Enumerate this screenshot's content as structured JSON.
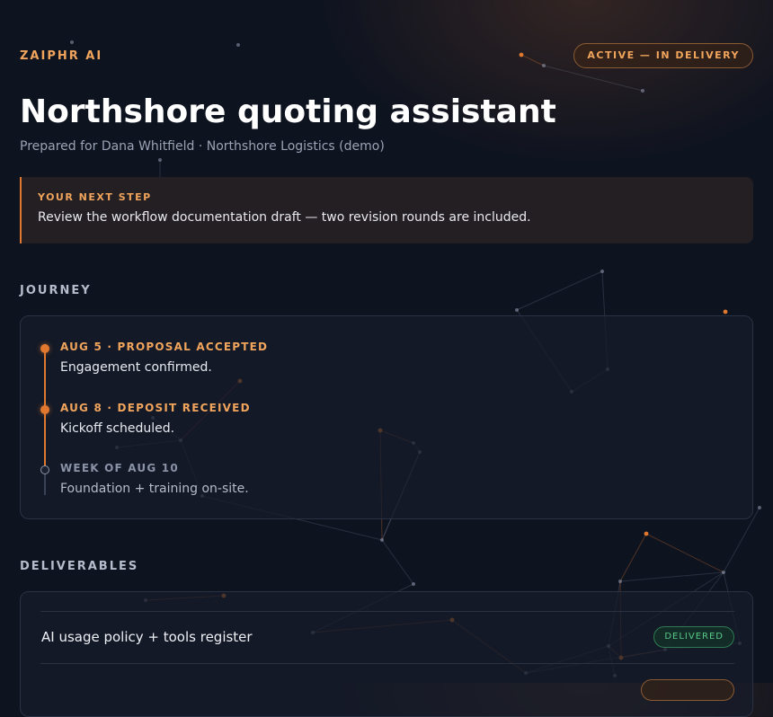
{
  "header": {
    "brand": "ZAIPHR AI",
    "status": "ACTIVE — IN DELIVERY",
    "title": "Northshore quoting assistant",
    "subtitle": "Prepared for Dana Whitfield · Northshore Logistics (demo)"
  },
  "next_step": {
    "label": "YOUR NEXT STEP",
    "text": "Review the workflow documentation draft — two revision rounds are included."
  },
  "journey": {
    "heading": "JOURNEY",
    "items": [
      {
        "date": "AUG 5 · PROPOSAL ACCEPTED",
        "desc": "Engagement confirmed.",
        "state": "done"
      },
      {
        "date": "AUG 8 · DEPOSIT RECEIVED",
        "desc": "Kickoff scheduled.",
        "state": "done"
      },
      {
        "date": "WEEK OF AUG 10",
        "desc": "Foundation + training on-site.",
        "state": "pending"
      }
    ]
  },
  "deliverables": {
    "heading": "DELIVERABLES",
    "items": [
      {
        "name": "AI usage policy + tools register",
        "badge": "DELIVERED",
        "state": "delivered"
      },
      {
        "name": "",
        "badge": "",
        "state": "in-progress"
      }
    ]
  },
  "colors": {
    "accent": "#e0792f",
    "accent_text": "#f0a45c",
    "delivered": "#57c98a",
    "background": "#0e1320"
  }
}
